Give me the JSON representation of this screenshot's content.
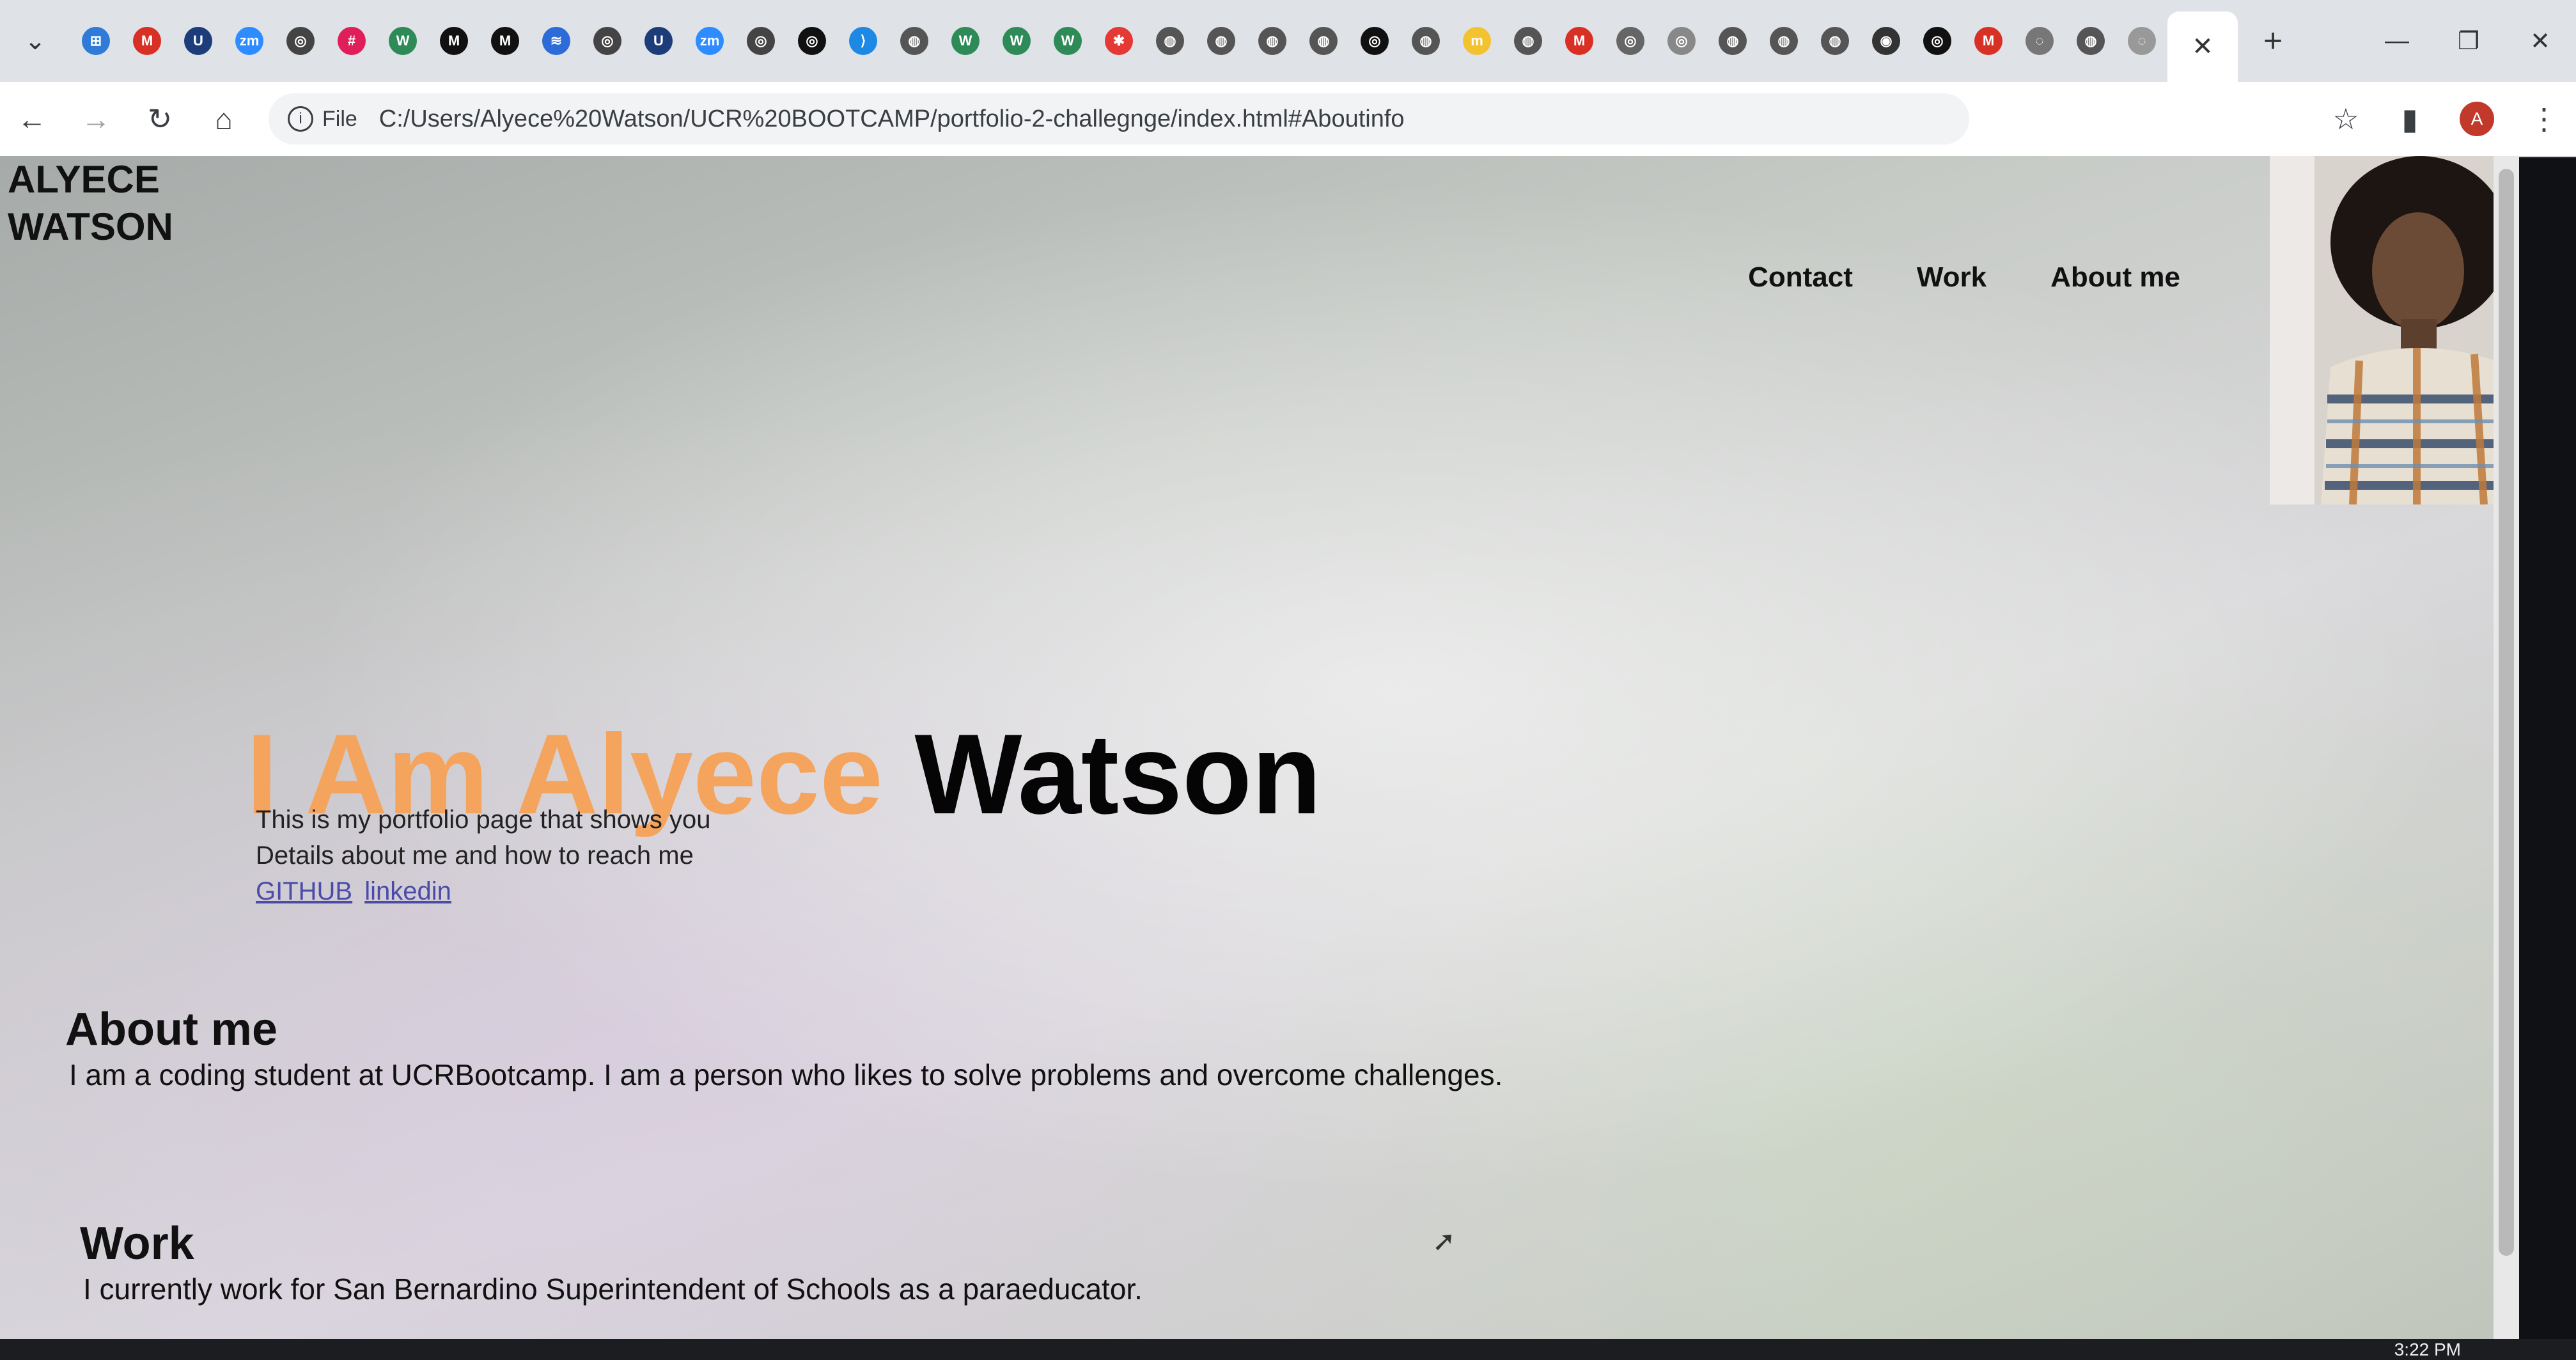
{
  "browser": {
    "tab_favicons": [
      {
        "name": "windows-icon",
        "glyph": "⊞",
        "color": "#2f7bd7"
      },
      {
        "name": "gmail-icon",
        "glyph": "M",
        "color": "#d93025"
      },
      {
        "name": "ucr-icon",
        "glyph": "U",
        "color": "#1c3d7a"
      },
      {
        "name": "zoom-icon",
        "glyph": "zm",
        "color": "#2d8cff"
      },
      {
        "name": "github-icon",
        "glyph": "◎",
        "color": "#444"
      },
      {
        "name": "slack-icon",
        "glyph": "#",
        "color": "#e01e5a"
      },
      {
        "name": "w-icon",
        "glyph": "W",
        "color": "#2e8b57"
      },
      {
        "name": "m-icon",
        "glyph": "M",
        "color": "#111"
      },
      {
        "name": "m-icon",
        "glyph": "M",
        "color": "#111"
      },
      {
        "name": "stack-icon",
        "glyph": "≋",
        "color": "#2d6bd8"
      },
      {
        "name": "github-icon",
        "glyph": "◎",
        "color": "#444"
      },
      {
        "name": "ucr-icon",
        "glyph": "U",
        "color": "#1c3d7a"
      },
      {
        "name": "zoom-icon",
        "glyph": "zm",
        "color": "#2d8cff"
      },
      {
        "name": "github-icon",
        "glyph": "◎",
        "color": "#444"
      },
      {
        "name": "github-icon",
        "glyph": "◎",
        "color": "#111"
      },
      {
        "name": "vscode-icon",
        "glyph": "⟩",
        "color": "#1e88e5"
      },
      {
        "name": "globe-icon",
        "glyph": "◍",
        "color": "#555"
      },
      {
        "name": "w-icon",
        "glyph": "W",
        "color": "#2e8b57"
      },
      {
        "name": "w-icon",
        "glyph": "W",
        "color": "#2e8b57"
      },
      {
        "name": "w-icon",
        "glyph": "W",
        "color": "#2e8b57"
      },
      {
        "name": "asterisk-icon",
        "glyph": "✱",
        "color": "#e53935"
      },
      {
        "name": "globe-icon",
        "glyph": "◍",
        "color": "#555"
      },
      {
        "name": "globe-icon",
        "glyph": "◍",
        "color": "#555"
      },
      {
        "name": "globe-icon",
        "glyph": "◍",
        "color": "#555"
      },
      {
        "name": "globe-icon",
        "glyph": "◍",
        "color": "#555"
      },
      {
        "name": "github-icon",
        "glyph": "◎",
        "color": "#111"
      },
      {
        "name": "globe-icon",
        "glyph": "◍",
        "color": "#555"
      },
      {
        "name": "miro-icon",
        "glyph": "m",
        "color": "#f2c230"
      },
      {
        "name": "globe-icon",
        "glyph": "◍",
        "color": "#555"
      },
      {
        "name": "gmail-icon",
        "glyph": "M",
        "color": "#d93025"
      },
      {
        "name": "github-icon",
        "glyph": "◎",
        "color": "#666"
      },
      {
        "name": "github-icon",
        "glyph": "◎",
        "color": "#888"
      },
      {
        "name": "globe-icon",
        "glyph": "◍",
        "color": "#555"
      },
      {
        "name": "globe-icon",
        "glyph": "◍",
        "color": "#555"
      },
      {
        "name": "globe-icon",
        "glyph": "◍",
        "color": "#555"
      },
      {
        "name": "target-icon",
        "glyph": "◉",
        "color": "#333"
      },
      {
        "name": "github-icon",
        "glyph": "◎",
        "color": "#111"
      },
      {
        "name": "gmail-icon",
        "glyph": "M",
        "color": "#d93025"
      },
      {
        "name": "loading-icon",
        "glyph": "◌",
        "color": "#777"
      },
      {
        "name": "globe-icon",
        "glyph": "◍",
        "color": "#555"
      },
      {
        "name": "loading-icon",
        "glyph": "◌",
        "color": "#999"
      }
    ],
    "url_prefix": "File",
    "url": "C:/Users/Alyece%20Watson/UCR%20BOOTCAMP/portfolio-2-challegnge/index.html#Aboutinfo",
    "profile_initial": "A"
  },
  "page": {
    "logo_line1": "ALYECE",
    "logo_line2": "WATSON",
    "nav": [
      "Contact",
      "Work",
      "About me"
    ],
    "hero_title_accent": "I Am Alyece",
    "hero_title_dark": "Watson",
    "hero_line1": "This is my portfolio page that shows you",
    "hero_line2": "Details about me and how to reach me",
    "link_github": "GITHUB",
    "link_linkedin": "linkedin",
    "about_heading": "About me",
    "about_text": "I am a coding student at UCRBootcamp. I am a person who likes to solve problems and overcome challenges.",
    "work_heading": "Work",
    "work_text": "I currently work for San Bernardino Superintendent of Schools as a paraeducator."
  },
  "taskbar": {
    "clock": "3:22 PM"
  }
}
